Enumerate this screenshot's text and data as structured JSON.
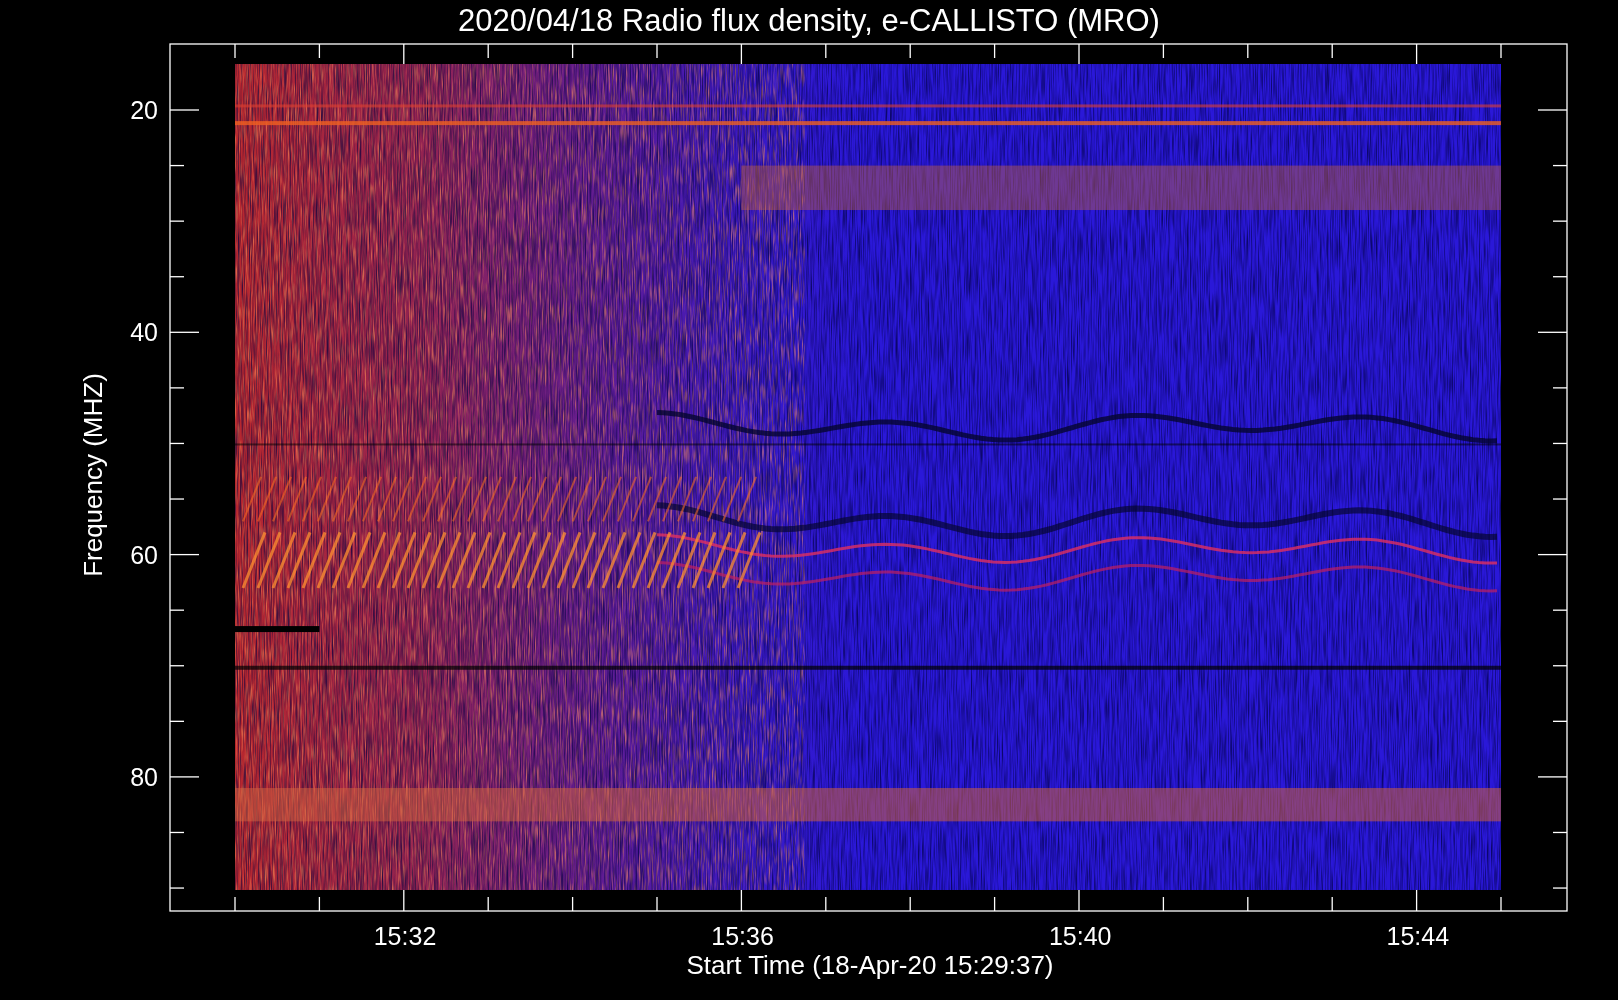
{
  "title": "2020/04/18  Radio flux density, e-CALLISTO (MRO)",
  "y_axis": {
    "label": "Frequency (MHZ)",
    "ticks": [
      "20",
      "40",
      "60",
      "80"
    ]
  },
  "x_axis": {
    "label": "Start Time (18-Apr-20 15:29:37)",
    "ticks": [
      "15:32",
      "15:36",
      "15:40",
      "15:44"
    ]
  }
}
